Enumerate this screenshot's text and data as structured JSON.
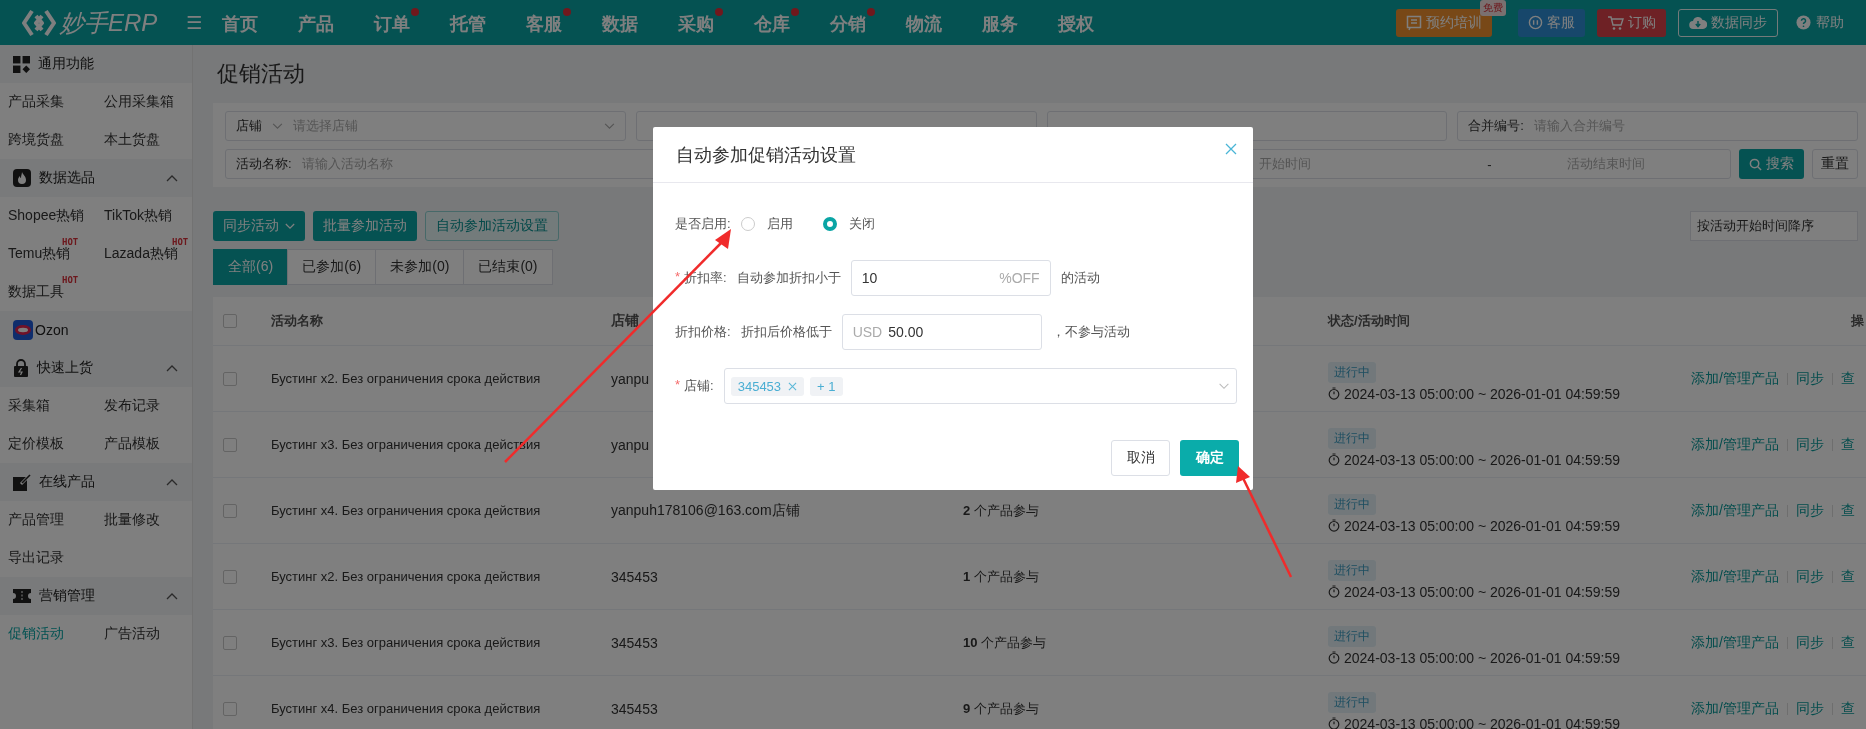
{
  "topbar": {
    "logo": "妙手ERP",
    "menu_glyph": "☰",
    "nav": [
      {
        "label": "首页",
        "dot": false
      },
      {
        "label": "产品",
        "dot": false
      },
      {
        "label": "订单",
        "dot": true
      },
      {
        "label": "托管",
        "dot": false
      },
      {
        "label": "客服",
        "dot": true
      },
      {
        "label": "数据",
        "dot": false
      },
      {
        "label": "采购",
        "dot": true
      },
      {
        "label": "仓库",
        "dot": true
      },
      {
        "label": "分销",
        "dot": true
      },
      {
        "label": "物流",
        "dot": false
      },
      {
        "label": "服务",
        "dot": false
      },
      {
        "label": "授权",
        "dot": false
      }
    ],
    "actions": [
      {
        "kind": "training",
        "label": "预约培训",
        "badge": "免费"
      },
      {
        "kind": "service",
        "label": "客服"
      },
      {
        "kind": "order",
        "label": "订购"
      },
      {
        "kind": "sync",
        "label": "数据同步"
      },
      {
        "kind": "help",
        "label": "帮助"
      }
    ]
  },
  "sidebar": {
    "groups": [
      {
        "title": "通用功能",
        "items": [
          {
            "label": "产品采集",
            "selected": false
          },
          {
            "label": "公用采集箱",
            "selected": false
          },
          {
            "label": "跨境货盘",
            "selected": false
          },
          {
            "label": "本土货盘",
            "selected": false
          }
        ]
      },
      {
        "title": "数据选品",
        "expanded": true,
        "items": [
          {
            "label": "Shopee热销",
            "selected": false
          },
          {
            "label": "TikTok热销",
            "selected": false
          },
          {
            "label": "Temu热销",
            "tag": "HOT",
            "selected": false
          },
          {
            "label": "Lazada热销",
            "tag": "HOT",
            "selected": false
          },
          {
            "label": "数据工具",
            "tag": "HOT",
            "selected": false
          }
        ]
      },
      {
        "title": "Ozon"
      },
      {
        "title": "快速上货",
        "expanded": true,
        "items": [
          {
            "label": "采集箱",
            "selected": false
          },
          {
            "label": "发布记录",
            "selected": false
          },
          {
            "label": "定价模板",
            "selected": false
          },
          {
            "label": "产品模板",
            "selected": false
          }
        ]
      },
      {
        "title": "在线产品",
        "expanded": true,
        "items": [
          {
            "label": "产品管理",
            "selected": false
          },
          {
            "label": "批量修改",
            "selected": false
          },
          {
            "label": "导出记录",
            "selected": false
          }
        ]
      },
      {
        "title": "营销管理",
        "expanded": true,
        "items": [
          {
            "label": "促销活动",
            "selected": true
          },
          {
            "label": "广告活动",
            "selected": false
          }
        ]
      }
    ]
  },
  "page_title": "促销活动",
  "filters": {
    "store": {
      "label": "店铺",
      "placeholder": "请选择店铺"
    },
    "merge_no": {
      "label": "合并编号:",
      "placeholder": "请输入合并编号"
    },
    "activity_name": {
      "label": "活动名称:",
      "placeholder": "请输入活动名称"
    },
    "date_range": {
      "start_placeholder": "开始时间",
      "separator": "-",
      "end_placeholder": "活动结束时间"
    },
    "search": "搜索",
    "reset": "重置"
  },
  "toolbar": {
    "buttons": [
      {
        "kind": "dropdown",
        "label": "同步活动"
      },
      {
        "kind": "primary",
        "label": "批量参加活动"
      },
      {
        "kind": "light",
        "label": "自动参加活动设置"
      }
    ],
    "sort": "按活动开始时间降序"
  },
  "tabs": [
    {
      "label": "全部(6)",
      "selected": true
    },
    {
      "label": "已参加(6)",
      "selected": false
    },
    {
      "label": "未参加(0)",
      "selected": false
    },
    {
      "label": "已结束(0)",
      "selected": false
    }
  ],
  "table": {
    "header_checked": false,
    "columns": {
      "name": "活动名称",
      "store": "店铺",
      "status": "状态/活动时间",
      "actions": "操"
    },
    "rows": [
      {
        "checked": false,
        "name": "Бустинг x2. Без ограничения срока действия",
        "store": "yanpu",
        "status": "进行中",
        "time": "2024-03-13 05:00:00 ~ 2026-01-01 04:59:59",
        "actions": [
          "添加/管理产品",
          "同步",
          "查"
        ]
      },
      {
        "checked": false,
        "name": "Бустинг x3. Без ограничения срока действия",
        "store": "yanpu",
        "status": "进行中",
        "time": "2024-03-13 05:00:00 ~ 2026-01-01 04:59:59",
        "actions": [
          "添加/管理产品",
          "同步",
          "查"
        ]
      },
      {
        "checked": false,
        "name": "Бустинг x4. Без ограничения срока действия",
        "store": "yanpuh178106@163.com店铺",
        "products": "**2** 个产品参与",
        "status": "进行中",
        "time": "2024-03-13 05:00:00 ~ 2026-01-01 04:59:59",
        "actions": [
          "添加/管理产品",
          "同步",
          "查"
        ]
      },
      {
        "checked": false,
        "name": "Бустинг x2. Без ограничения срока действия",
        "store": "345453",
        "products": "**1** 个产品参与",
        "status": "进行中",
        "time": "2024-03-13 05:00:00 ~ 2026-01-01 04:59:59",
        "actions": [
          "添加/管理产品",
          "同步",
          "查"
        ]
      },
      {
        "checked": false,
        "name": "Бустинг x3. Без ограничения срока действия",
        "store": "345453",
        "products": "**10** 个产品参与",
        "status": "进行中",
        "time": "2024-03-13 05:00:00 ~ 2026-01-01 04:59:59",
        "actions": [
          "添加/管理产品",
          "同步",
          "查"
        ]
      },
      {
        "checked": false,
        "name": "Бустинг x4. Без ограничения срока действия",
        "store": "345453",
        "products": "**9** 个产品参与",
        "status": "进行中",
        "time": "2024-03-13 05:00:00 ~ 2026-01-01 04:59:59",
        "actions": [
          "添加/管理产品",
          "同步",
          "查"
        ]
      }
    ]
  },
  "dialog": {
    "title": "自动参加促销活动设置",
    "enable": {
      "label": "是否启用:",
      "options": [
        {
          "label": "启用",
          "selected": false
        },
        {
          "label": "关闭",
          "selected": true
        }
      ]
    },
    "discount": {
      "required_mark": "*",
      "label": "折扣率:",
      "prefix": "自动参加折扣小于",
      "value": "10",
      "suffix": "%OFF",
      "after": "的活动"
    },
    "price": {
      "label": "折扣价格:",
      "prefix": "折扣后价格低于",
      "currency": "USD",
      "value": "50.00",
      "after": "，不参与活动"
    },
    "store": {
      "required_mark": "*",
      "label": "店铺:",
      "tags": [
        {
          "label": "345453",
          "closable": true
        },
        {
          "label": "+ 1",
          "closable": false
        }
      ]
    },
    "buttons": [
      {
        "kind": "cancel",
        "label": "取消"
      },
      {
        "kind": "confirm",
        "label": "确定"
      }
    ]
  }
}
